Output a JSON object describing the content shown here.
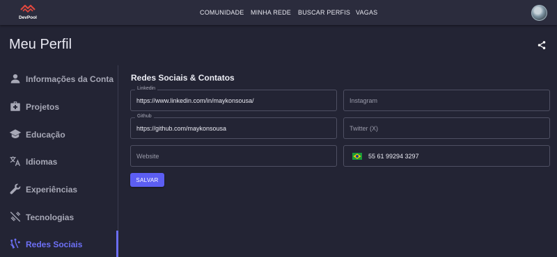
{
  "app": {
    "logo_text": "DevPool",
    "nav": [
      "COMUNIDADE",
      "MINHA REDE",
      "BUSCAR PERFIS",
      "VAGAS"
    ],
    "avatar_icon": "user-avatar"
  },
  "page": {
    "title": "Meu Perfil",
    "share_icon": "share-icon"
  },
  "sidebar": {
    "items": [
      {
        "label": "Informações da Conta",
        "icon": "person-icon"
      },
      {
        "label": "Projetos",
        "icon": "medical-briefcase-icon"
      },
      {
        "label": "Educação",
        "icon": "graduation-cap-icon"
      },
      {
        "label": "Idiomas",
        "icon": "translate-icon"
      },
      {
        "label": "Experiências",
        "icon": "wrench-icon"
      },
      {
        "label": "Tecnologias",
        "icon": "tools-off-icon"
      },
      {
        "label": "Redes Sociais",
        "icon": "social-network-icon",
        "active": true
      }
    ],
    "active_color": "#6d70f6"
  },
  "form": {
    "section_title": "Redes Sociais & Contatos",
    "linkedin": {
      "label": "Linkedin",
      "value": "https://www.linkedin.com/in/maykonsousa/"
    },
    "instagram": {
      "placeholder": "Instagram"
    },
    "github": {
      "label": "Github",
      "value": "https://github.com/maykonsousa"
    },
    "twitter": {
      "placeholder": "Twitter (X)"
    },
    "website": {
      "placeholder": "Website"
    },
    "phone": {
      "value": "55 61 99294 3297",
      "flag": "brazil-flag-icon"
    },
    "save_label": "SALVAR"
  },
  "colors": {
    "background": "#232434",
    "topbar": "#2b2c3d",
    "accent": "#5c5ef2"
  }
}
